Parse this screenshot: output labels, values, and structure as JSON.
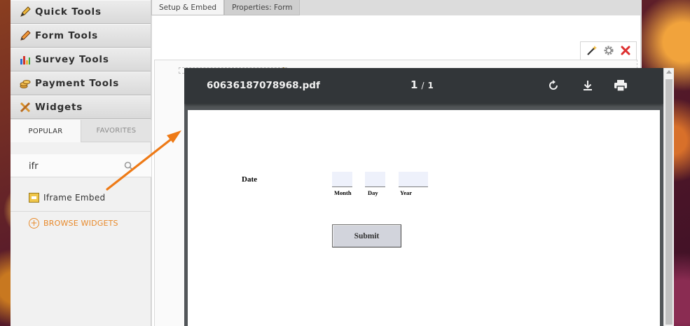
{
  "sidebar": {
    "categories": [
      {
        "label": "Quick Tools",
        "icon": "pencil-icon"
      },
      {
        "label": "Form Tools",
        "icon": "pen-icon"
      },
      {
        "label": "Survey Tools",
        "icon": "bar-chart-icon"
      },
      {
        "label": "Payment Tools",
        "icon": "coins-icon"
      },
      {
        "label": "Widgets",
        "icon": "tools-icon"
      }
    ],
    "tabs": {
      "popular": "POPULAR",
      "favorites": "FAVORITES"
    },
    "search": {
      "value": "ifr"
    },
    "widget_result": {
      "label": "Iframe Embed",
      "icon": "iframe-icon"
    },
    "browse_label": "BROWSE WIDGETS"
  },
  "editor": {
    "tabs": [
      "Setup & Embed",
      "Properties: Form"
    ],
    "toolbar_icons": [
      "magic-wand-icon",
      "gear-icon",
      "close-icon"
    ]
  },
  "pdf": {
    "filename": "60636187078968.pdf",
    "page_current": "1",
    "page_separator": "/",
    "page_total": "1",
    "form": {
      "date_label": "Date",
      "month_label": "Month",
      "day_label": "Day",
      "year_label": "Year",
      "submit_label": "Submit"
    }
  },
  "colors": {
    "accent_orange": "#e8892a",
    "pdf_toolbar": "#323639",
    "pdf_background": "#525659"
  }
}
